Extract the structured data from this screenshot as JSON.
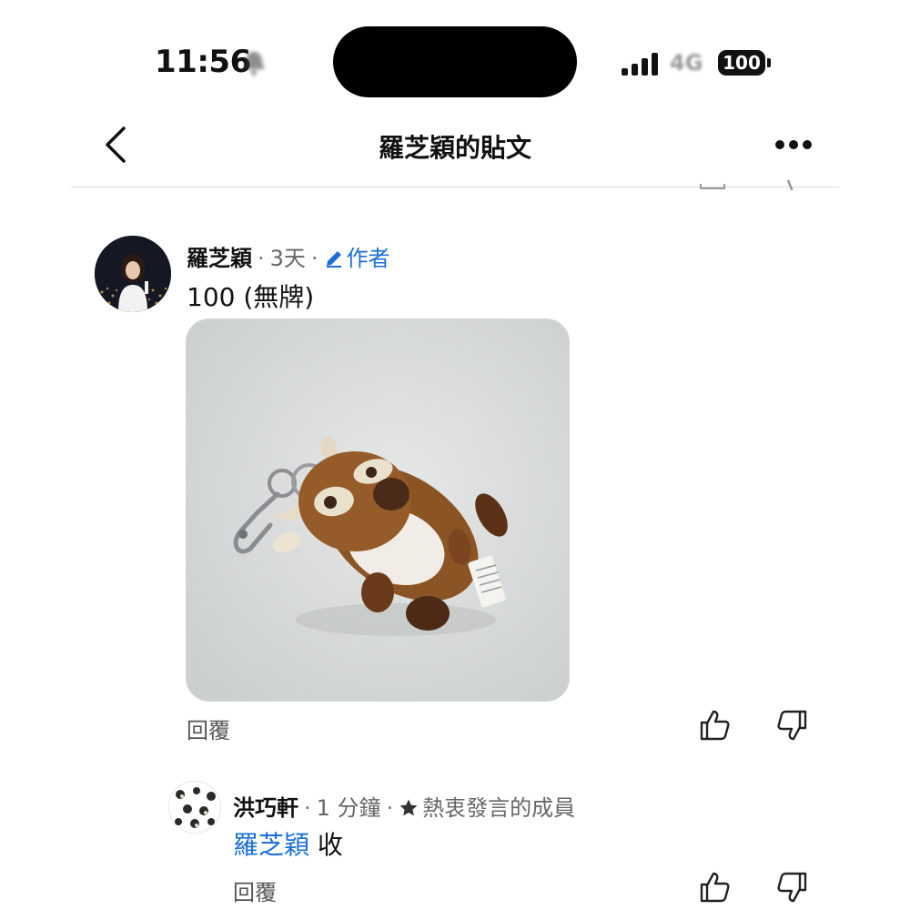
{
  "status_bar": {
    "time": "11:56",
    "network": "4G",
    "battery": "100"
  },
  "header": {
    "title": "羅芝穎的貼文"
  },
  "comments": [
    {
      "author": "羅芝穎",
      "time": "3天",
      "badge": "作者",
      "text": "100 (無牌)",
      "photo_subject": "plush-reindeer-keychain",
      "reply_label": "回覆"
    },
    {
      "author": "洪巧軒",
      "time": "1 分鐘",
      "badge": "熱衷發言的成員",
      "mention": "羅芝穎",
      "text": "收",
      "reply_label": "回覆"
    }
  ],
  "colors": {
    "link_blue": "#1a6fd6",
    "muted_gray": "#666666",
    "divider": "#dcdcdc"
  },
  "icons": {
    "back": "chevron-left-icon",
    "more": "more-dots-icon",
    "author_badge": "pencil-icon",
    "member_badge": "star-icon",
    "like": "thumbs-up-icon",
    "dislike": "thumbs-down-icon"
  }
}
